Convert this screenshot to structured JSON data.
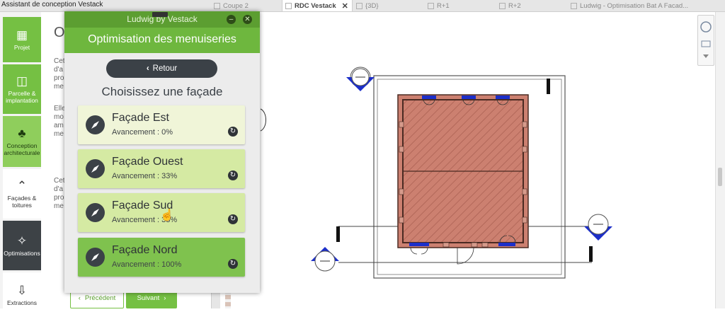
{
  "app_title": "Assistant de conception Vestack",
  "tabs": [
    {
      "label": "Coupe 2",
      "active": false
    },
    {
      "label": "RDC Vestack",
      "active": true
    },
    {
      "label": "{3D}",
      "active": false
    },
    {
      "label": "R+1",
      "active": false
    },
    {
      "label": "R+2",
      "active": false
    },
    {
      "label": "Ludwig - Optimisation Bat A Facad...",
      "active": false
    }
  ],
  "sidebar": {
    "items": [
      {
        "label": "Projet",
        "icon": "building-icon"
      },
      {
        "label": "Parcelle & implantation",
        "icon": "map-icon"
      },
      {
        "label": "Conception architecturale",
        "icon": "lamp-icon"
      },
      {
        "label": "Façades & toitures",
        "icon": "roof-icon"
      },
      {
        "label": "Optimisations",
        "icon": "magic-wand-icon"
      },
      {
        "label": "Extractions",
        "icon": "download-icon"
      }
    ]
  },
  "left_panel": {
    "title_fragment": "O",
    "text_lines_1": [
      "Cet",
      "d'a",
      "pro",
      "me"
    ],
    "text_lines_2": [
      "Elle",
      "mo",
      "am",
      "me"
    ],
    "text_lines_3": [
      "Cet",
      "d'a",
      "pro",
      "me"
    ]
  },
  "footer": {
    "prev_label": "Précédent",
    "next_label": "Suivant"
  },
  "modal": {
    "window_title": "Ludwig by Vestack",
    "header": "Optimisation des menuiseries",
    "back_label": "Retour",
    "subtitle": "Choisissez une façade",
    "facades": [
      {
        "name": "Façade Est",
        "progress": "Avancement : 0%",
        "progress_value": 0,
        "color": "#f0f5d8"
      },
      {
        "name": "Façade Ouest",
        "progress": "Avancement : 33%",
        "progress_value": 33,
        "color": "#d5eaa3"
      },
      {
        "name": "Façade Sud",
        "progress": "Avancement : 33%",
        "progress_value": 33,
        "color": "#d5eaa3"
      },
      {
        "name": "Façade Nord",
        "progress": "Avancement : 100%",
        "progress_value": 100,
        "color": "#7fc24e"
      }
    ]
  },
  "colors": {
    "brand_green": "#75c043",
    "dark_green": "#5c9e31",
    "dark_gray": "#3b4147",
    "building_fill": "#cc8070",
    "window_blue": "#1c2fc9"
  }
}
